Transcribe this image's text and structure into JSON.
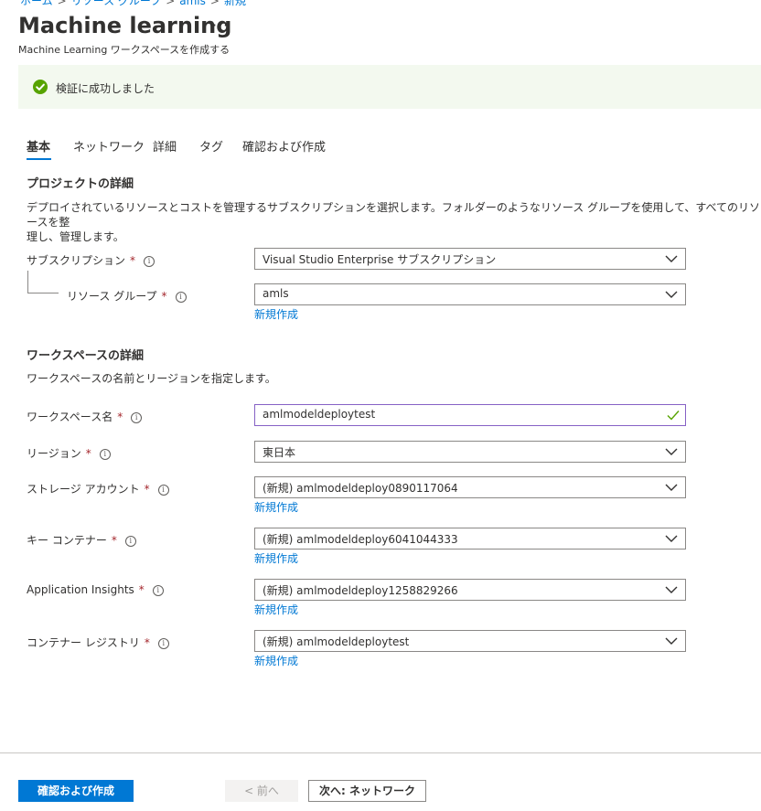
{
  "breadcrumb": {
    "items": [
      "ホーム",
      "リソース グループ",
      "amls",
      "新規"
    ]
  },
  "header": {
    "title": "Machine learning",
    "more": "···",
    "subtitle": "Machine Learning ワークスペースを作成する"
  },
  "banner": {
    "text": "検証に成功しました",
    "icon": "success-check-icon",
    "color": "#57a300"
  },
  "tabs": [
    {
      "label": "基本",
      "active": true
    },
    {
      "label": "ネットワーク"
    },
    {
      "label": "詳細"
    },
    {
      "label": "タグ"
    },
    {
      "label": "確認および作成"
    }
  ],
  "project": {
    "title": "プロジェクトの詳細",
    "description_line1": "デプロイされているリソースとコストを管理するサブスクリプションを選択します。フォルダーのようなリソース グループを使用して、すべてのリソースを整",
    "description_line2": "理し、管理します。"
  },
  "fields": {
    "subscription": {
      "label": "サブスクリプション",
      "value": "Visual Studio Enterprise サブスクリプション"
    },
    "resource_group": {
      "label": "リソース グループ",
      "value": "amls",
      "create_new": "新規作成"
    }
  },
  "workspace": {
    "title": "ワークスペースの詳細",
    "description": "ワークスペースの名前とリージョンを指定します。",
    "name": {
      "label": "ワークスペース名",
      "value": "amlmodeldeploytest"
    },
    "region": {
      "label": "リージョン",
      "value": "東日本"
    },
    "storage": {
      "label": "ストレージ アカウント",
      "value": "(新規) amlmodeldeploy0890117064",
      "create_new": "新規作成"
    },
    "keyvault": {
      "label": "キー コンテナー",
      "value": "(新規) amlmodeldeploy6041044333",
      "create_new": "新規作成"
    },
    "appinsights": {
      "label": "Application Insights",
      "value": "(新規) amlmodeldeploy1258829266",
      "create_new": "新規作成"
    },
    "registry": {
      "label": "コンテナー レジストリ",
      "value": "(新規) amlmodeldeploytest",
      "create_new": "新規作成"
    }
  },
  "common": {
    "required": "*",
    "info": "i"
  },
  "footer": {
    "review_create": "確認および作成",
    "previous": "< 前へ",
    "next": "次へ: ネットワーク"
  },
  "colors": {
    "accent": "#0078d4",
    "required": "#a4262c",
    "success": "#57a300",
    "banner_bg": "#f3f9ef",
    "focus_border": "#8661c5"
  }
}
